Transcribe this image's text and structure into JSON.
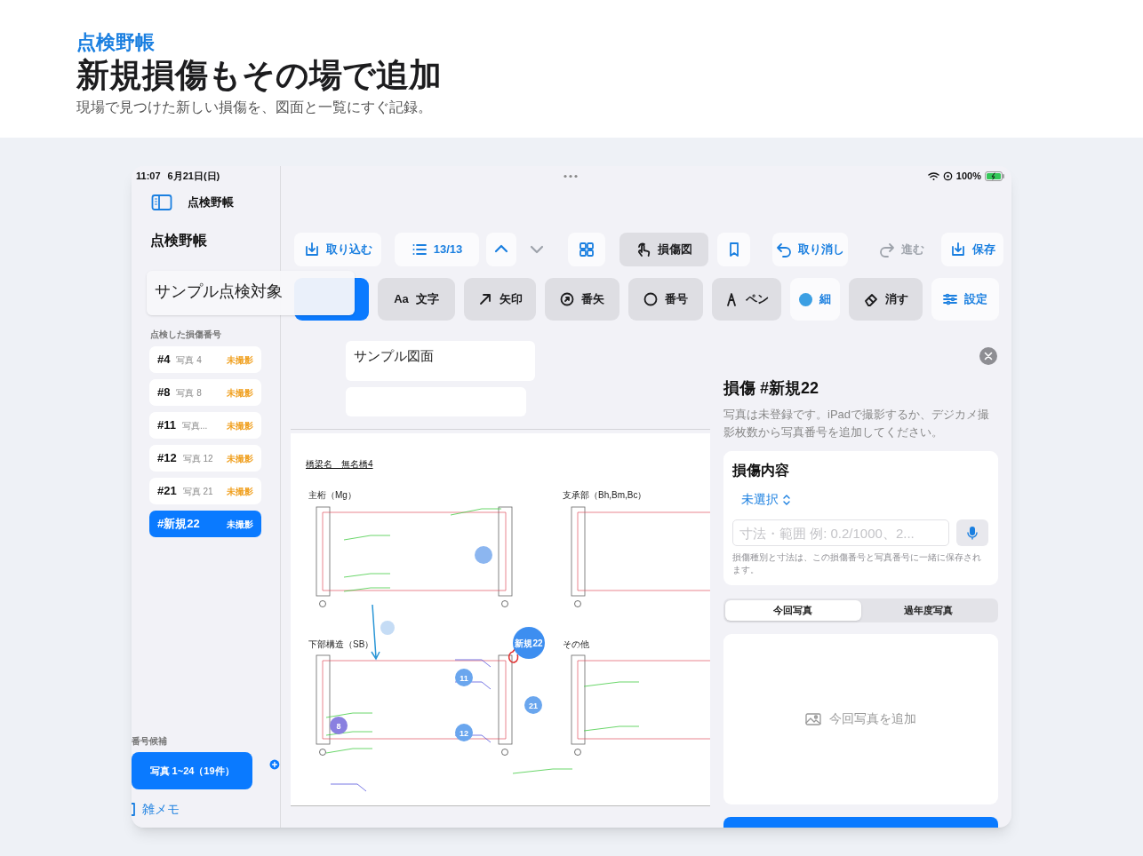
{
  "header": {
    "app_name": "点検野帳",
    "title": "新規損傷もその場で追加",
    "subtitle": "現場で見つけた新しい損傷を、図面と一覧にすぐ記録。"
  },
  "status_bar": {
    "time": "11:07",
    "date": "6月21日(日)",
    "battery": "100%"
  },
  "sidebar": {
    "app_title": "点検野帳",
    "heading": "点検野帳",
    "section_label": "点検した損傷番号",
    "items": [
      {
        "number": "#4",
        "photo": "写真 4",
        "status": "未撮影",
        "selected": false
      },
      {
        "number": "#8",
        "photo": "写真 8",
        "status": "未撮影",
        "selected": false
      },
      {
        "number": "#11",
        "photo": "写真...",
        "status": "未撮影",
        "selected": false
      },
      {
        "number": "#12",
        "photo": "写真 12",
        "status": "未撮影",
        "selected": false
      },
      {
        "number": "#21",
        "photo": "写真 21",
        "status": "未撮影",
        "selected": false
      },
      {
        "number": "#新規22",
        "status": "未撮影",
        "selected": true
      }
    ],
    "candidates_label": "番号候補",
    "candidate_button": "写真 1~24（19件）",
    "memo": "雑メモ"
  },
  "popup": {
    "text": "サンプル点検対象"
  },
  "toolbar": [
    {
      "label": "取り込む",
      "selected": false,
      "disabled": false
    },
    {
      "label": "13/13",
      "selected": false,
      "disabled": false
    },
    {
      "selected": false,
      "disabled": false
    },
    {
      "selected": false,
      "disabled": true
    },
    {
      "selected": false,
      "disabled": false
    },
    {
      "label": "損傷図",
      "selected": true,
      "disabled": false
    },
    {
      "selected": false,
      "disabled": false
    },
    {
      "label": "取り消し",
      "selected": false,
      "disabled": false
    },
    {
      "label": "進む",
      "selected": false,
      "disabled": true
    },
    {
      "label": "保存",
      "selected": false,
      "disabled": false
    }
  ],
  "tools": [
    {
      "kind": "tool",
      "glyph": "Aa",
      "label": "文字"
    },
    {
      "kind": "tool",
      "label": "矢印"
    },
    {
      "kind": "tool",
      "label": "番矢"
    },
    {
      "kind": "tool",
      "label": "番号"
    },
    {
      "kind": "tool",
      "label": "ペン"
    },
    {
      "kind": "color",
      "label": "細",
      "color": "#3b9fe3"
    },
    {
      "kind": "tool",
      "label": "消す"
    },
    {
      "kind": "plain",
      "label": "設定"
    }
  ],
  "sheet_cards": [
    {
      "kind": "titled",
      "title": "サンプル図面"
    },
    {
      "kind": "blank"
    }
  ],
  "drawing": {
    "title": "橋梁名　無名橋4",
    "sections": [
      "主桁（Mg）",
      "支承部（Bh,Bm,Bc）",
      "下部構造（SB）",
      "その他"
    ],
    "markers": [
      {
        "label": "8",
        "color": "#8a80e0"
      },
      {
        "label": "11",
        "color": "#6aa6ee"
      },
      {
        "label": "12",
        "color": "#6aa6ee"
      },
      {
        "label": "21",
        "color": "#6aa6ee"
      },
      {
        "label": "新規22",
        "color": "#3d8ef0"
      }
    ]
  },
  "detail": {
    "title": "損傷 #新規22",
    "description": "写真は未登録です。iPadで撮影するか、デジカメ撮影枚数から写真番号を追加してください。",
    "card_title": "損傷内容",
    "picker": "未選択",
    "input_placeholder": "寸法・範囲 例: 0.2/1000、2...",
    "help": "損傷種別と寸法は、この損傷番号と写真番号に一緒に保存されます。",
    "segments": [
      {
        "label": "今回写真",
        "selected": true
      },
      {
        "label": "過年度写真",
        "selected": false
      }
    ],
    "add_photo": "今回写真を追加"
  }
}
